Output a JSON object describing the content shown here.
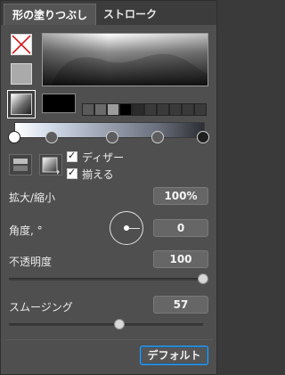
{
  "tabs": {
    "fill": "形の塗りつぶし",
    "stroke": "ストローク"
  },
  "swatches": {
    "mini_colors": [
      "#5a5a5a",
      "#6a6a6a",
      "#9c9c9c",
      "#000000",
      "#2b2b2b",
      "#3a3a3a",
      "#3a3a3a",
      "#3a3a3a",
      "#3a3a3a",
      "#3a3a3a"
    ],
    "current_color": "#000000"
  },
  "gradient_stops": [
    "#ffffff",
    "#5d5d5d",
    "#5d5d5d",
    "#5d5d5d",
    "#1f1f1f"
  ],
  "options": {
    "dither_label": "ディザー",
    "align_label": "揃える"
  },
  "fields": {
    "scale": {
      "label": "拡大/縮小",
      "value": "100%"
    },
    "angle": {
      "label": "角度, °",
      "value": "0"
    },
    "opacity": {
      "label": "不透明度",
      "value": "100",
      "slider_value": 1.0
    },
    "smoothing": {
      "label": "スムージング",
      "value": "57",
      "slider_value": 0.57
    }
  },
  "default_button": "デフォルト",
  "accent_color": "#2aa0ff"
}
